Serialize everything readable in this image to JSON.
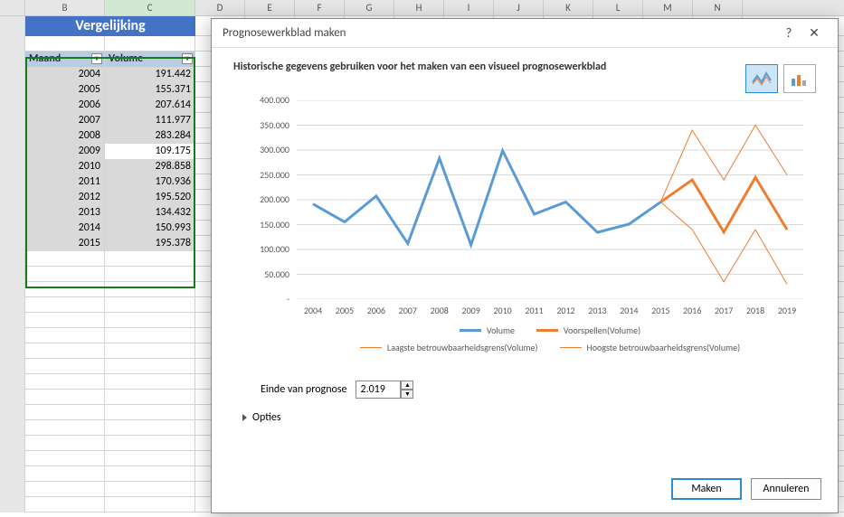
{
  "column_letters": [
    "B",
    "C",
    "D",
    "E",
    "F",
    "G",
    "H",
    "I",
    "J",
    "K",
    "L",
    "M",
    "N"
  ],
  "merged_title": "Vergelijking",
  "table": {
    "headers": [
      "Maand",
      "Volume"
    ],
    "rows": [
      {
        "y": "2004",
        "v": "191.442"
      },
      {
        "y": "2005",
        "v": "155.371"
      },
      {
        "y": "2006",
        "v": "207.614"
      },
      {
        "y": "2007",
        "v": "111.977"
      },
      {
        "y": "2008",
        "v": "283.284"
      },
      {
        "y": "2009",
        "v": "109.175",
        "white": true
      },
      {
        "y": "2010",
        "v": "298.858"
      },
      {
        "y": "2011",
        "v": "170.936"
      },
      {
        "y": "2012",
        "v": "195.520"
      },
      {
        "y": "2013",
        "v": "134.432"
      },
      {
        "y": "2014",
        "v": "150.993"
      },
      {
        "y": "2015",
        "v": "195.378"
      }
    ]
  },
  "dialog": {
    "title": "Prognosewerkblad maken",
    "help": "?",
    "close": "✕",
    "subtitle": "Historische gegevens gebruiken voor het maken van een visueel prognosewerkblad",
    "end_label": "Einde van prognose",
    "end_value": "2.019",
    "options": "Opties",
    "btn_make": "Maken",
    "btn_cancel": "Annuleren",
    "legend": {
      "l1": "Volume",
      "l2": "Voorspellen(Volume)",
      "l3": "Laagste betrouwbaarheidsgrens(Volume)",
      "l4": "Hoogste betrouwbaarheidsgrens(Volume)"
    }
  },
  "chart_data": {
    "type": "line",
    "x": [
      2004,
      2005,
      2006,
      2007,
      2008,
      2009,
      2010,
      2011,
      2012,
      2013,
      2014,
      2015,
      2016,
      2017,
      2018,
      2019
    ],
    "ylim": [
      0,
      400000
    ],
    "yticks": [
      "-",
      "50.000",
      "100.000",
      "150.000",
      "200.000",
      "250.000",
      "300.000",
      "350.000",
      "400.000"
    ],
    "xticks": [
      "2004",
      "2005",
      "2006",
      "2007",
      "2008",
      "2009",
      "2010",
      "2011",
      "2012",
      "2013",
      "2014",
      "2015",
      "2016",
      "2017",
      "2018",
      "2019"
    ],
    "series": [
      {
        "name": "Volume",
        "color": "#5b9bd5",
        "width": 3,
        "values": [
          191442,
          155371,
          207614,
          111977,
          283284,
          109175,
          298858,
          170936,
          195520,
          134432,
          150993,
          195378,
          null,
          null,
          null,
          null
        ]
      },
      {
        "name": "Voorspellen(Volume)",
        "color": "#ed7d31",
        "width": 3,
        "values": [
          null,
          null,
          null,
          null,
          null,
          null,
          null,
          null,
          null,
          null,
          null,
          195378,
          240000,
          135000,
          245000,
          140000
        ]
      },
      {
        "name": "Laagste betrouwbaarheidsgrens(Volume)",
        "color": "#ed7d31",
        "width": 1,
        "values": [
          null,
          null,
          null,
          null,
          null,
          null,
          null,
          null,
          null,
          null,
          null,
          195378,
          140000,
          35000,
          140000,
          30000
        ]
      },
      {
        "name": "Hoogste betrouwbaarheidsgrens(Volume)",
        "color": "#ed7d31",
        "width": 1,
        "values": [
          null,
          null,
          null,
          null,
          null,
          null,
          null,
          null,
          null,
          null,
          null,
          195378,
          340000,
          240000,
          350000,
          250000
        ]
      }
    ]
  }
}
